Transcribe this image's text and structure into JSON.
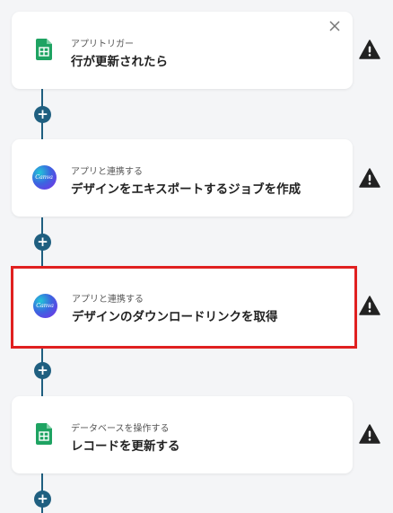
{
  "steps": [
    {
      "category": "アプリトリガー",
      "title": "行が更新されたら",
      "app_icon": "google-sheets-icon"
    },
    {
      "category": "アプリと連携する",
      "title": "デザインをエキスポートするジョブを作成",
      "app_icon": "canva-icon",
      "icon_text": "Canva"
    },
    {
      "category": "アプリと連携する",
      "title": "デザインのダウンロードリンクを取得",
      "app_icon": "canva-icon",
      "icon_text": "Canva"
    },
    {
      "category": "データベースを操作する",
      "title": "レコードを更新する",
      "app_icon": "google-sheets-icon"
    }
  ],
  "add_button_symbol": "+",
  "colors": {
    "connector": "#1f5f80",
    "highlight": "#e02020",
    "sheets_green": "#1ea362",
    "warning": "#222222"
  }
}
